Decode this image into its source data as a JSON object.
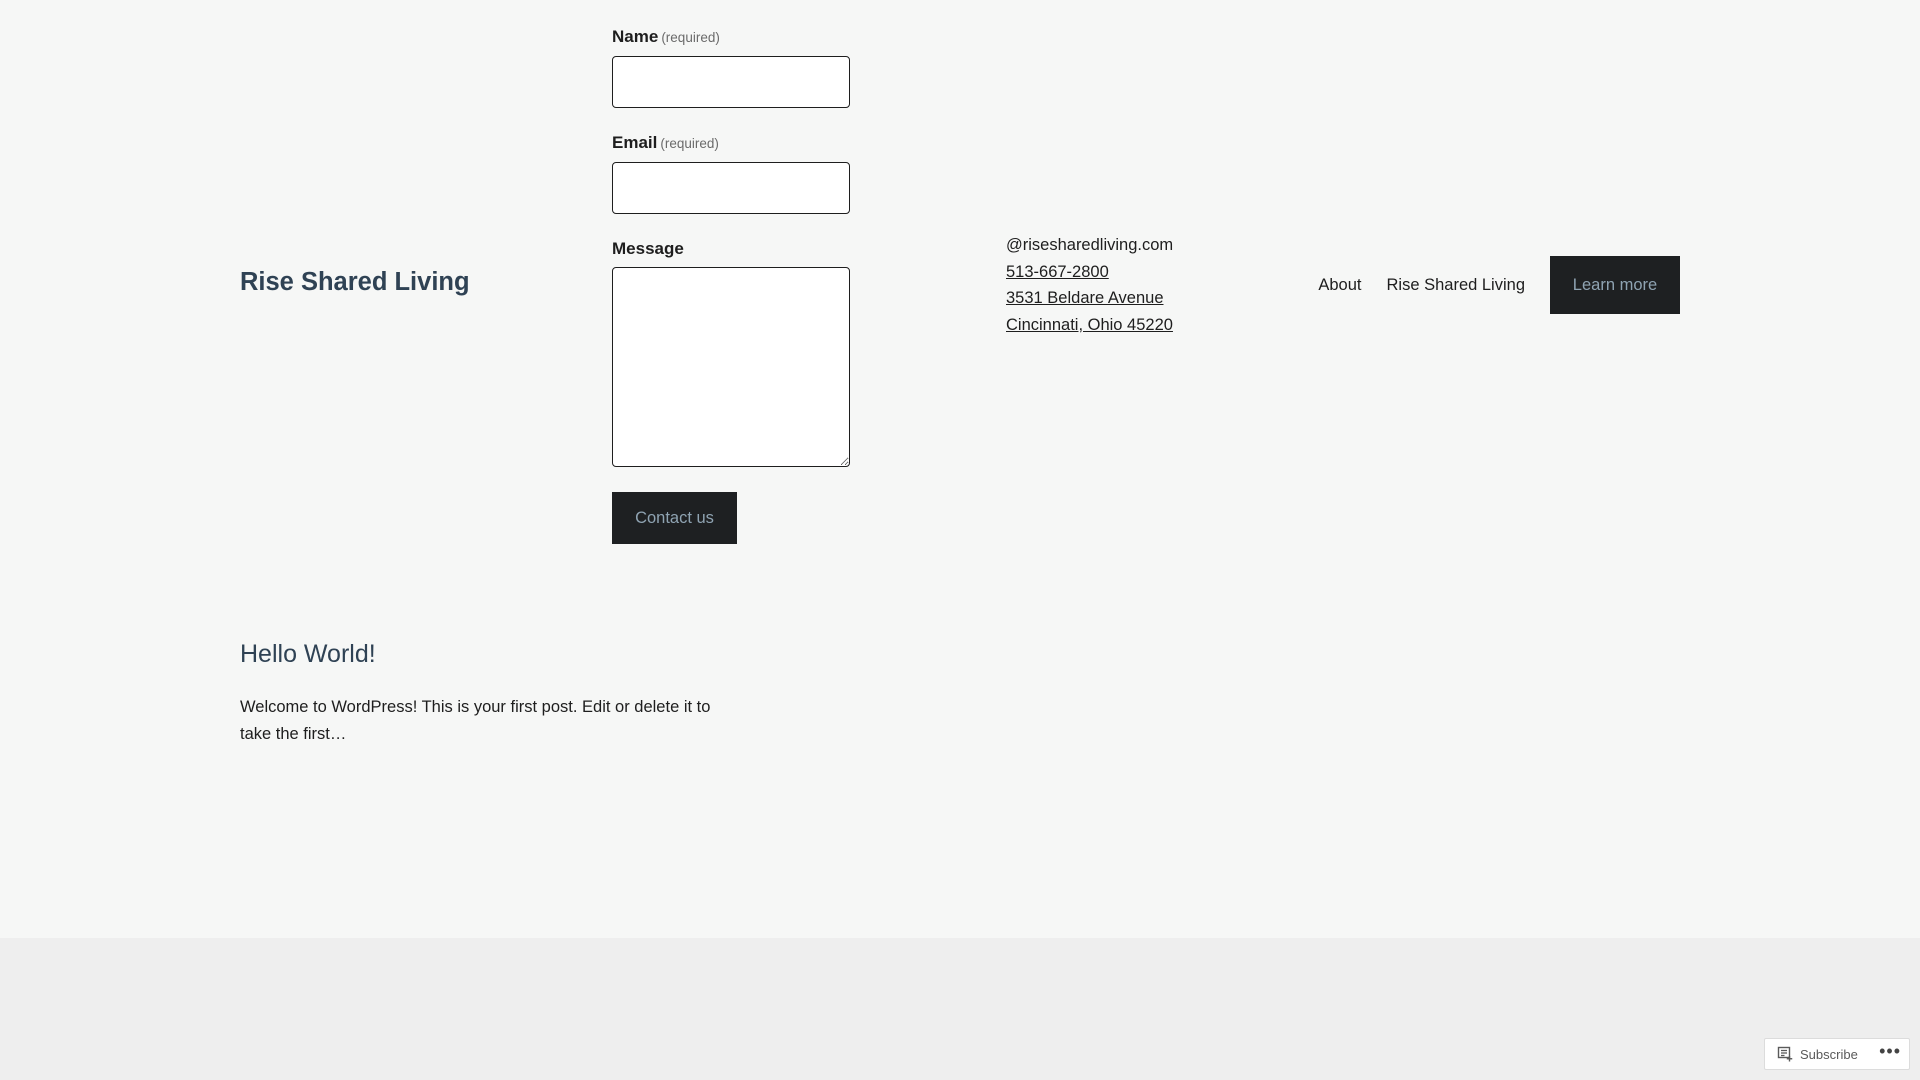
{
  "header": {
    "site_title": "Rise Shared Living",
    "nav": [
      {
        "label": "About"
      },
      {
        "label": "Rise Shared Living"
      }
    ],
    "cta_label": "Learn more"
  },
  "contact_form": {
    "name_label": "Name",
    "email_label": "Email",
    "message_label": "Message",
    "required_note": "(required)",
    "name_value": "",
    "email_value": "",
    "message_value": "",
    "submit_label": "Contact us"
  },
  "contact_info": {
    "email": "@risesharedliving.com",
    "phone": "513-667-2800",
    "address_line1": "3531 Beldare Avenue",
    "address_line2": "Cincinnati, Ohio 45220"
  },
  "post": {
    "title": "Hello World!",
    "excerpt": "Welcome to WordPress! This is your first post. Edit or delete it to take the first…"
  },
  "subscribe_widget": {
    "subscribe_label": "Subscribe",
    "icon": "reader-icon",
    "more_icon": "more-dots-icon",
    "more_glyph": "•••"
  },
  "colors": {
    "page_background": "#f6f7f6",
    "footer_background": "#eeeeee",
    "button_background": "#1e2022",
    "button_text": "#8fa3b2",
    "heading_color": "#2f4254"
  }
}
